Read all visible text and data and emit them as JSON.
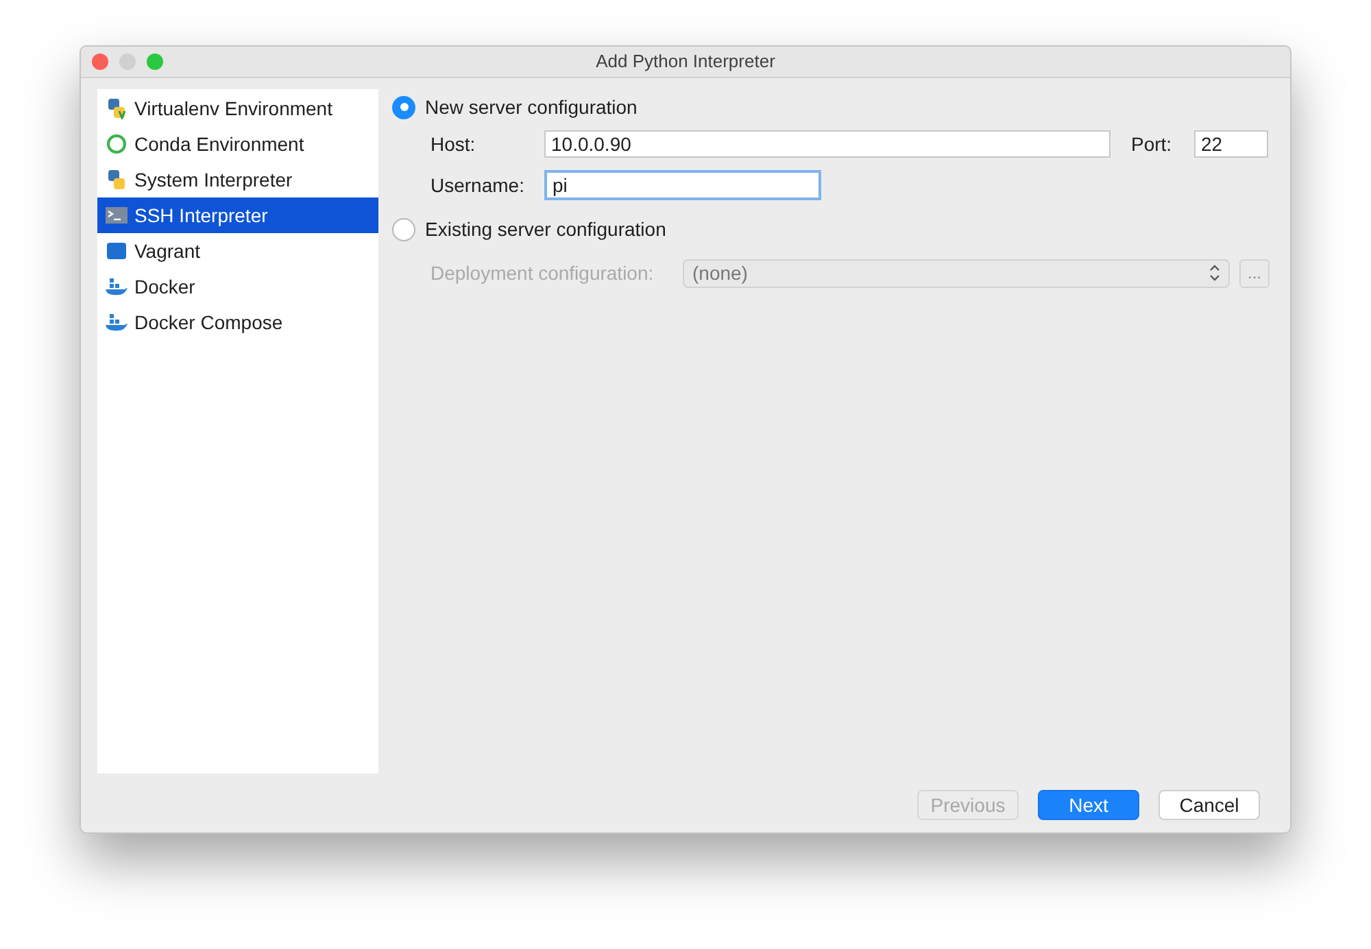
{
  "window": {
    "title": "Add Python Interpreter"
  },
  "sidebar": {
    "items": [
      {
        "label": "Virtualenv Environment",
        "kind": "virtualenv",
        "selected": false
      },
      {
        "label": "Conda Environment",
        "kind": "conda",
        "selected": false
      },
      {
        "label": "System Interpreter",
        "kind": "python",
        "selected": false
      },
      {
        "label": "SSH Interpreter",
        "kind": "ssh",
        "selected": true
      },
      {
        "label": "Vagrant",
        "kind": "vagrant",
        "selected": false
      },
      {
        "label": "Docker",
        "kind": "docker",
        "selected": false
      },
      {
        "label": "Docker Compose",
        "kind": "docker",
        "selected": false
      }
    ]
  },
  "new_server": {
    "label": "New server configuration",
    "selected": true,
    "host": {
      "label": "Host:",
      "value": "10.0.0.90"
    },
    "port": {
      "label": "Port:",
      "value": "22"
    },
    "username": {
      "label": "Username:",
      "value": "pi",
      "focused": true
    }
  },
  "existing_server": {
    "label": "Existing server configuration",
    "selected": false,
    "deployment": {
      "label": "Deployment configuration:",
      "value": "(none)",
      "disabled": true,
      "browse": "..."
    }
  },
  "buttons": [
    {
      "label": "Previous",
      "kind": "secondary",
      "disabled": true
    },
    {
      "label": "Next",
      "kind": "primary",
      "disabled": false
    },
    {
      "label": "Cancel",
      "kind": "secondary",
      "disabled": false
    }
  ]
}
